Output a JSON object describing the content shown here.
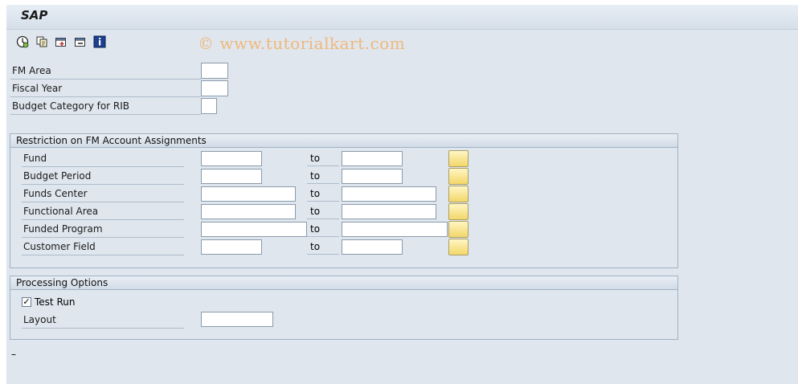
{
  "window": {
    "title": "SAP"
  },
  "toolbar": {
    "icons": [
      "execute-icon",
      "copy-icon",
      "add-selection-icon",
      "delete-selection-icon",
      "info-icon"
    ],
    "watermark": "© www.tutorialkart.com"
  },
  "header_fields": {
    "fm_area": "FM Area",
    "fiscal_year": "Fiscal Year",
    "budget_category": "Budget Category for RIB"
  },
  "restriction": {
    "title": "Restriction on FM Account Assignments",
    "to_label": "to",
    "rows": [
      {
        "label": "Fund"
      },
      {
        "label": "Budget Period"
      },
      {
        "label": "Funds Center"
      },
      {
        "label": "Functional Area"
      },
      {
        "label": "Funded Program"
      },
      {
        "label": "Customer Field"
      }
    ]
  },
  "processing": {
    "title": "Processing Options",
    "test_run_label": "Test Run",
    "test_run_checked": true,
    "layout_label": "Layout"
  },
  "status": {
    "text": "–"
  },
  "colors": {
    "multi_select_button": "#f5dc75",
    "background": "#dfe6ee"
  }
}
